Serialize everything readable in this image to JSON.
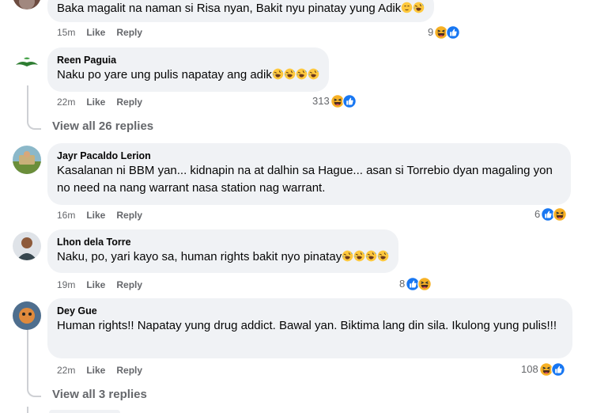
{
  "comments": [
    {
      "author": "",
      "text": "Baka magalit na naman si Risa nyan, Bakit nyu pinatay yung Adik",
      "time": "15m",
      "like": "Like",
      "reply": "Reply",
      "reaction_count": "9"
    },
    {
      "author": "Reen Paguia",
      "text": "Naku po yare ung pulis napatay ang adik",
      "time": "22m",
      "like": "Like",
      "reply": "Reply",
      "reaction_count": "313",
      "view_replies": "View all 26 replies"
    },
    {
      "author": "Jayr Pacaldo Lerion",
      "text": "Kasalanan ni BBM yan... kidnapin na at dalhin sa Hague... asan si Torrebio dyan magaling yon no need na nang warrant nasa station nag warrant.",
      "time": "16m",
      "like": "Like",
      "reply": "Reply",
      "reaction_count": "6"
    },
    {
      "author": "Lhon dela Torre",
      "text": "Naku, po, yari kayo sa, human rights bakit nyo pinatay",
      "time": "19m",
      "like": "Like",
      "reply": "Reply",
      "reaction_count": "8"
    },
    {
      "author": "Dey Gue",
      "text": "Human rights!! Napatay yung drug addict. Bawal yan. Biktima lang din sila. Ikulong yung pulis!!!",
      "time": "22m",
      "like": "Like",
      "reply": "Reply",
      "reaction_count": "108",
      "view_replies": "View all 3 replies"
    }
  ],
  "icons": {
    "like": "like-reaction-icon",
    "haha": "haha-reaction-icon",
    "rofl": "rolling-laughing-emoji"
  },
  "colors": {
    "bubble": "#f0f2f5",
    "like_blue": "#1877f2",
    "meta_gray": "#65676b",
    "haha_yellow": "#f7b125"
  }
}
